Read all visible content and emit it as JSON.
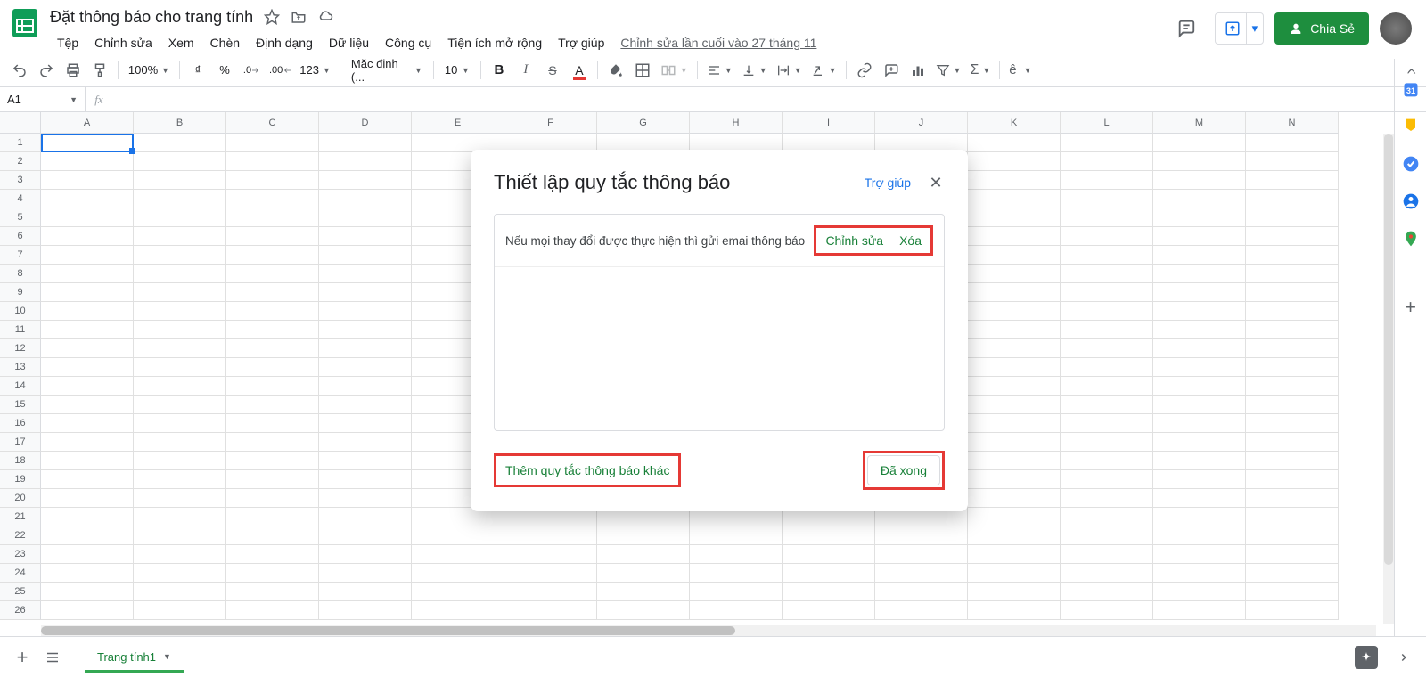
{
  "header": {
    "doc_title": "Đặt thông báo cho trang tính",
    "last_edit": "Chỉnh sửa lần cuối vào 27 tháng 11",
    "share_label": "Chia Sẻ"
  },
  "menu": {
    "file": "Tệp",
    "edit": "Chỉnh sửa",
    "view": "Xem",
    "insert": "Chèn",
    "format": "Định dạng",
    "data": "Dữ liệu",
    "tools": "Công cụ",
    "extensions": "Tiện ích mở rộng",
    "help": "Trợ giúp"
  },
  "toolbar": {
    "zoom": "100%",
    "currency": "₫",
    "percent": "%",
    "dec_dec": ".0",
    "inc_dec": ".00",
    "numfmt": "123",
    "font": "Mặc định (...",
    "fontsize": "10"
  },
  "fx": {
    "cell": "A1",
    "label": "fx"
  },
  "columns": [
    "A",
    "B",
    "C",
    "D",
    "E",
    "F",
    "G",
    "H",
    "I",
    "J",
    "K",
    "L",
    "M",
    "N"
  ],
  "rowcount": 26,
  "sheet": {
    "tab": "Trang tính1"
  },
  "dialog": {
    "title": "Thiết lập quy tắc thông báo",
    "help": "Trợ giúp",
    "rule_text": "Nếu mọi thay đổi được thực hiện thì gửi emai thông báo",
    "edit": "Chỉnh sửa",
    "delete": "Xóa",
    "add_rule": "Thêm quy tắc thông báo khác",
    "done": "Đã xong"
  }
}
